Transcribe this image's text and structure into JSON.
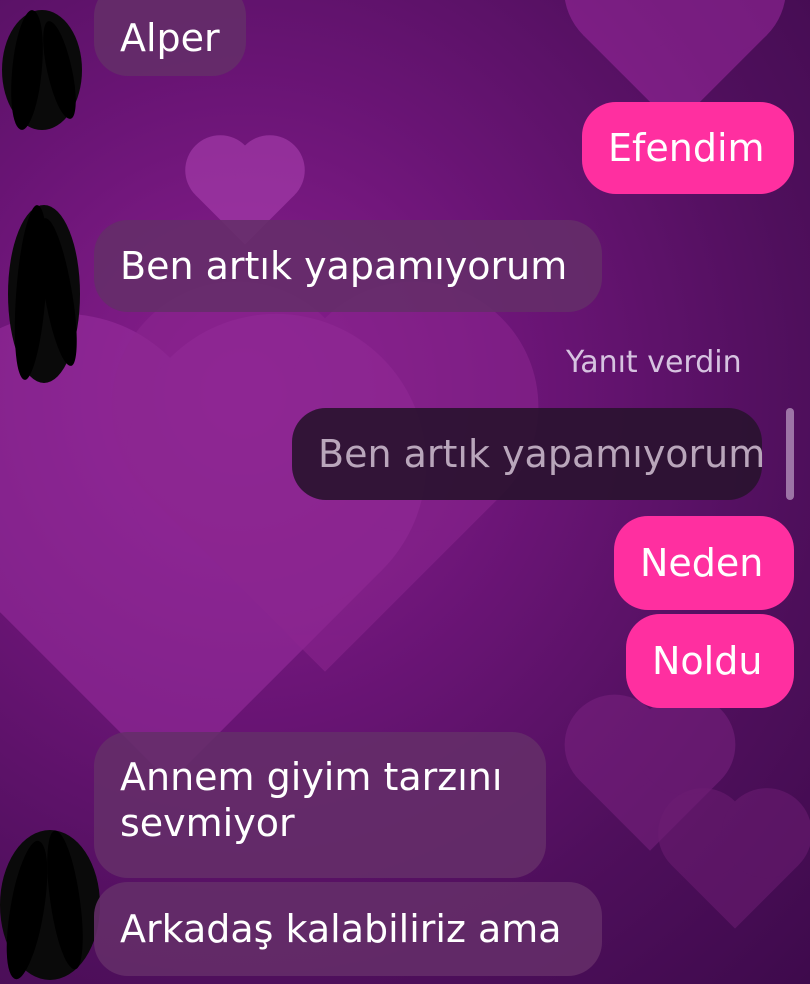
{
  "chat": {
    "messages": [
      {
        "id": "m1",
        "sender": "other",
        "text": "Alper"
      },
      {
        "id": "m2",
        "sender": "me",
        "text": "Efendim"
      },
      {
        "id": "m3",
        "sender": "other",
        "text": "Ben artık yapamıyorum"
      },
      {
        "id": "m4",
        "sender": "me",
        "reply_label": "Yanıt verdin",
        "quoted_text": "Ben artık yapamıyorum"
      },
      {
        "id": "m5",
        "sender": "me",
        "text": "Neden"
      },
      {
        "id": "m6",
        "sender": "me",
        "text": "Noldu"
      },
      {
        "id": "m7",
        "sender": "other",
        "text": "Annem giyim tarzını sevmiyor"
      },
      {
        "id": "m8",
        "sender": "other",
        "text": "Arkadaş kalabiliriz ama"
      }
    ]
  },
  "theme": {
    "outgoing_bubble": "#ff2fa0",
    "incoming_bubble": "#642d69",
    "background": "#6c1577",
    "background_motif": "heart-icon"
  }
}
